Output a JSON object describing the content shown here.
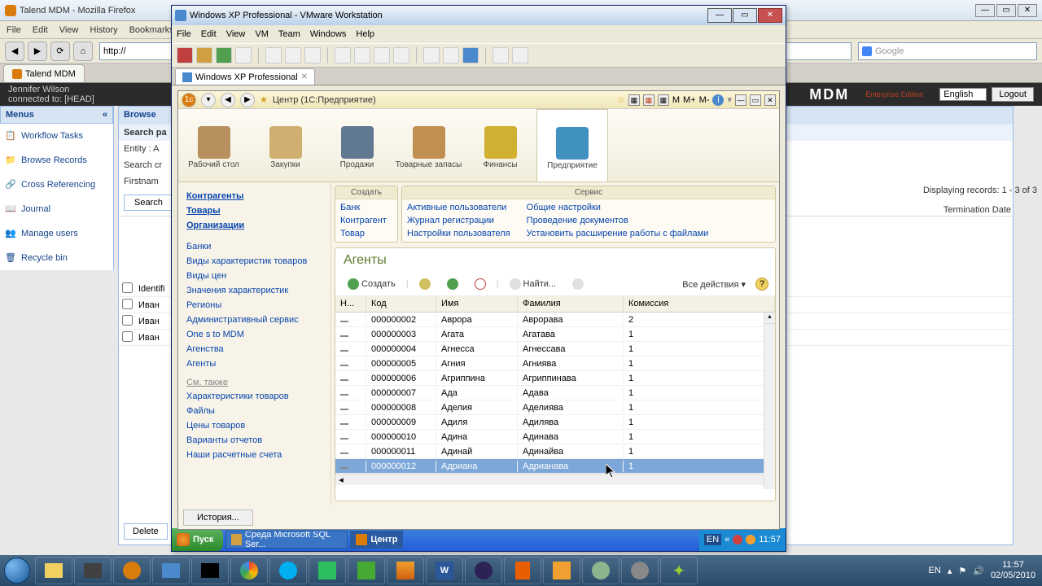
{
  "firefox": {
    "title": "Talend MDM - Mozilla Firefox",
    "menus": [
      "File",
      "Edit",
      "View",
      "History",
      "Bookmarks"
    ],
    "url_prefix": "http://",
    "search_placeholder": "Google",
    "tab_label": "Talend MDM"
  },
  "mdm": {
    "user_line1": "Jennifer Wilson",
    "user_line2": "connected to: [HEAD]",
    "logo": "MDM",
    "logo_sub": "Enterprise Edition",
    "language": "English",
    "logout": "Logout",
    "menus_header": "Menus",
    "menu_items": [
      "Workflow Tasks",
      "Browse Records",
      "Cross Referencing",
      "Journal",
      "Manage users",
      "Recycle bin"
    ],
    "browse_header": "Browse",
    "search_panel": "Search pa",
    "entity_label": "Entity :  A",
    "criteria_label": "Search cr",
    "firstname_label": "Firstnam",
    "search_button": "Search",
    "records_info": "Displaying records: 1 - 3 of 3",
    "term_date": "Termination Date",
    "grid_rows": [
      "Identifi",
      "Иван",
      "Иван",
      "Иван"
    ],
    "delete_button": "Delete"
  },
  "vmware": {
    "title": "Windows XP Professional - VMware Workstation",
    "menus": [
      "File",
      "Edit",
      "View",
      "VM",
      "Team",
      "Windows",
      "Help"
    ],
    "tab": "Windows XP Professional"
  },
  "ic": {
    "title": "Центр  (1С:Предприятие)",
    "toolbar_right": [
      "M",
      "M+",
      "M-"
    ],
    "ribbon": [
      {
        "label": "Рабочий стол",
        "color": "#b89060"
      },
      {
        "label": "Закупки",
        "color": "#d0b070"
      },
      {
        "label": "Продажи",
        "color": "#607890"
      },
      {
        "label": "Товарные запасы",
        "color": "#c09050"
      },
      {
        "label": "Финансы",
        "color": "#d0b030"
      },
      {
        "label": "Предприятие",
        "color": "#4090c0"
      }
    ],
    "sidebar_main": [
      "Контрагенты",
      "Товары",
      "Организации"
    ],
    "sidebar_links": [
      "Банки",
      "Виды характеристик товаров",
      "Виды цен",
      "Значения характеристик",
      "Регионы",
      "Административный сервис",
      "One s to MDM",
      "Агенства",
      "Агенты"
    ],
    "sidebar_see_also_hdr": "См. также",
    "sidebar_see_also": [
      "Характеристики товаров",
      "Файлы",
      "Цены товаров",
      "Варианты отчетов",
      "Наши расчетные счета"
    ],
    "create_panel": {
      "header": "Создать",
      "items": [
        "Банк",
        "Контрагент",
        "Товар"
      ]
    },
    "service_panel": {
      "header": "Сервис",
      "col1": [
        "Активные пользователи",
        "Журнал регистрации",
        "Настройки пользователя"
      ],
      "col2": [
        "Общие настройки",
        "Проведение документов",
        "Установить расширение работы с файлами"
      ]
    },
    "content_title": "Агенты",
    "toolbar": {
      "create": "Создать",
      "find": "Найти...",
      "all_actions": "Все действия ▾"
    },
    "columns": {
      "n": "Н...",
      "code": "Код",
      "name": "Имя",
      "surname": "Фамилия",
      "commission": "Комиссия"
    },
    "rows": [
      {
        "code": "000000002",
        "name": "Аврора",
        "surname": "Аврорава",
        "comm": "2"
      },
      {
        "code": "000000003",
        "name": "Агата",
        "surname": "Агатава",
        "comm": "1"
      },
      {
        "code": "000000004",
        "name": "Агнесса",
        "surname": "Агнессава",
        "comm": "1"
      },
      {
        "code": "000000005",
        "name": "Агния",
        "surname": "Агниява",
        "comm": "1"
      },
      {
        "code": "000000006",
        "name": "Агриппина",
        "surname": "Агриппинава",
        "comm": "1"
      },
      {
        "code": "000000007",
        "name": "Ада",
        "surname": "Адава",
        "comm": "1"
      },
      {
        "code": "000000008",
        "name": "Аделия",
        "surname": "Аделиява",
        "comm": "1"
      },
      {
        "code": "000000009",
        "name": "Адиля",
        "surname": "Адилява",
        "comm": "1"
      },
      {
        "code": "000000010",
        "name": "Адина",
        "surname": "Адинава",
        "comm": "1"
      },
      {
        "code": "000000011",
        "name": "Адинай",
        "surname": "Адинайва",
        "comm": "1"
      },
      {
        "code": "000000012",
        "name": "Адриана",
        "surname": "Адрианава",
        "comm": "1"
      }
    ],
    "selected_row": 10,
    "history_button": "История..."
  },
  "xp_taskbar": {
    "start": "Пуск",
    "tasks": [
      "Среда Microsoft SQL Ser...",
      "Центр"
    ],
    "tray_time": "11:57"
  },
  "w7_taskbar": {
    "lang": "EN",
    "time": "11:57",
    "date": "02/05/2010"
  }
}
